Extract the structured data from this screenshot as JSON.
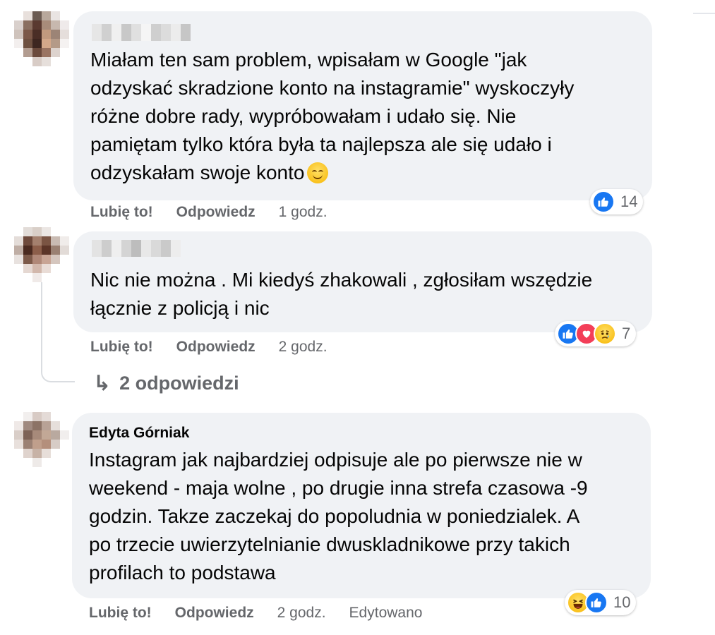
{
  "comments": [
    {
      "author": "",
      "text": "Miałam ten sam problem, wpisałam w Google \"jak\nodzyskać skradzione konto na instagramie\" wyskoczyły\nróżne dobre rady, wypróbowałam i udało się. Nie\npamiętam tylko która była ta najlepsza ale się udało i\nodzyskałam swoje konto",
      "emoji": "smiling-face",
      "like_label": "Lubię to!",
      "reply_label": "Odpowiedz",
      "time": "1 godz.",
      "reactions": [
        "like"
      ],
      "reaction_count": "14"
    },
    {
      "author": "",
      "text": "Nic nie można . Mi kiedyś zhakowali , zgłosiłam wszędzie\nłącznie z policją i nic",
      "like_label": "Lubię to!",
      "reply_label": "Odpowiedz",
      "time": "2 godz.",
      "reactions": [
        "like",
        "love",
        "sad"
      ],
      "reaction_count": "7",
      "replies_label": "2 odpowiedzi"
    },
    {
      "author": "Edyta Górniak",
      "text": "Instagram jak najbardziej odpisuje ale po pierwsze nie w\nweekend - maja wolne , po drugie inna strefa czasowa -9\ngodzin. Takze zaczekaj do popoludnia w poniedzialek. A\npo trzecie uwierzytelnianie dwuskladnikowe przy takich\nprofilach to podstawa",
      "like_label": "Lubię to!",
      "reply_label": "Odpowiedz",
      "time": "2 godz.",
      "edited_label": "Edytowano",
      "reactions": [
        "haha",
        "like"
      ],
      "reaction_count": "10"
    }
  ],
  "colors": {
    "bubble": "#f0f2f5",
    "meta_text": "#65676b",
    "like_blue": "#1877f2",
    "love_red": "#f33e58"
  }
}
